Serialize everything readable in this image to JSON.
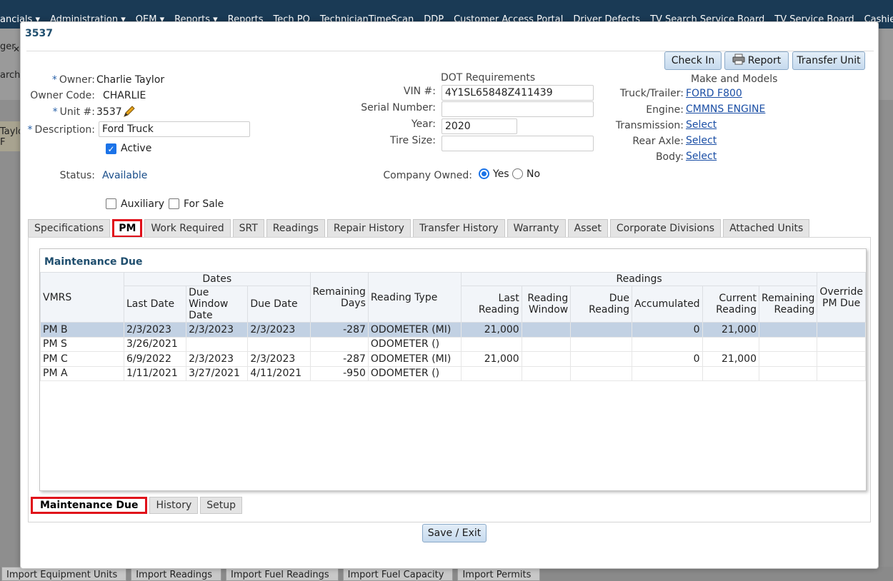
{
  "background": {
    "menu": [
      "ancials ▾",
      "Administration ▾",
      "OEM ▾",
      "Reports ▾",
      "Reports",
      "Tech PO",
      "TechnicianTimeScan",
      "DDP",
      "Customer Access Portal",
      "Driver Defects",
      "TV Search Service Board",
      "TV Service Board",
      "Cashier Shift"
    ],
    "left_tab": "ger",
    "left_search": "arch",
    "left_name": "Taylor",
    "left_f": "F",
    "bottom_buttons": [
      "Import Equipment Units",
      "Import Readings",
      "Import Fuel Readings",
      "Import Fuel Capacity",
      "Import Permits"
    ]
  },
  "modal": {
    "title": "3537",
    "buttons": {
      "check_in": "Check In",
      "report": "Report",
      "transfer": "Transfer Unit"
    },
    "left": {
      "owner_label": "Owner:",
      "owner_value": "Charlie Taylor",
      "owner_code_label": "Owner Code:",
      "owner_code_value": "CHARLIE",
      "unit_label": "Unit #:",
      "unit_value": "3537",
      "description_label": "Description:",
      "description_value": "Ford Truck",
      "active_label": "Active",
      "status_label": "Status:",
      "status_value": "Available",
      "auxiliary_label": "Auxiliary",
      "for_sale_label": "For Sale"
    },
    "middle": {
      "heading": "DOT Requirements",
      "vin_label": "VIN #:",
      "vin_value": "4Y1SL65848Z411439",
      "serial_label": "Serial Number:",
      "serial_value": "",
      "year_label": "Year:",
      "year_value": "2020",
      "tire_label": "Tire Size:",
      "tire_value": "",
      "company_owned_label": "Company Owned:",
      "yes_label": "Yes",
      "no_label": "No"
    },
    "right": {
      "heading": "Make and Models",
      "truck_label": "Truck/Trailer:",
      "truck_value": "FORD F800",
      "engine_label": "Engine:",
      "engine_value": "CMMNS ENGINE",
      "transmission_label": "Transmission:",
      "transmission_value": "Select",
      "rear_axle_label": "Rear Axle:",
      "rear_axle_value": "Select",
      "body_label": "Body:",
      "body_value": "Select"
    },
    "tabs": [
      "Specifications",
      "PM",
      "Work Required",
      "SRT",
      "Readings",
      "Repair History",
      "Transfer History",
      "Warranty",
      "Asset",
      "Corporate Divisions",
      "Attached Units"
    ],
    "grid": {
      "title": "Maintenance Due",
      "group_dates": "Dates",
      "group_readings": "Readings",
      "columns": {
        "vmrs": "VMRS",
        "last_date": "Last Date",
        "due_window_date": "Due Window Date",
        "due_date": "Due Date",
        "remaining_days": "Remaining Days",
        "reading_type": "Reading Type",
        "last_reading": "Last Reading",
        "reading_window": "Reading Window",
        "due_reading": "Due Reading",
        "accumulated": "Accumulated",
        "current_reading": "Current Reading",
        "remaining_reading": "Remaining Reading",
        "override": "Override PM Due"
      },
      "rows": [
        [
          "PM B",
          "2/3/2023",
          "2/3/2023",
          "2/3/2023",
          "-287",
          "ODOMETER (MI)",
          "21,000",
          "",
          "",
          "0",
          "21,000",
          "",
          ""
        ],
        [
          "PM S",
          "3/26/2021",
          "",
          "",
          "",
          "ODOMETER ()",
          "",
          "",
          "",
          "",
          "",
          "",
          ""
        ],
        [
          "PM C",
          "6/9/2022",
          "2/3/2023",
          "2/3/2023",
          "-287",
          "ODOMETER (MI)",
          "21,000",
          "",
          "",
          "0",
          "21,000",
          "",
          ""
        ],
        [
          "PM A",
          "1/11/2021",
          "3/27/2021",
          "4/11/2021",
          "-950",
          "ODOMETER ()",
          "",
          "",
          "",
          "",
          "",
          "",
          ""
        ]
      ]
    },
    "bottom_tabs": [
      "Maintenance Due",
      "History",
      "Setup"
    ],
    "save_label": "Save / Exit"
  }
}
